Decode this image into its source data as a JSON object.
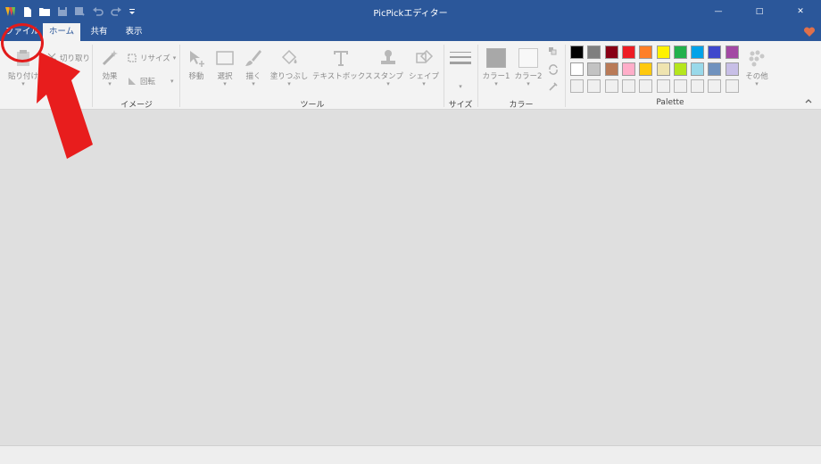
{
  "window": {
    "title": "PicPickエディター",
    "title_bar_color": "#2b579a"
  },
  "quick_access": {
    "icons": [
      "app-logo-icon",
      "new-file-icon",
      "open-folder-icon",
      "save-icon",
      "save-as-icon",
      "undo-icon",
      "redo-icon",
      "customize-icon"
    ]
  },
  "window_controls": {
    "minimize": "—",
    "maximize": "□",
    "close": "✕"
  },
  "tabs": [
    {
      "label": "ファイル"
    },
    {
      "label": "ホーム"
    },
    {
      "label": "共有"
    },
    {
      "label": "表示"
    }
  ],
  "ribbon": {
    "clipboard": {
      "paste": "貼り付け",
      "cut": "切り取り"
    },
    "image": {
      "label": "イメージ",
      "effects": "効果",
      "resize": "リサイズ",
      "rotate": "回転"
    },
    "tools": {
      "label": "ツール",
      "items": [
        "移動",
        "選択",
        "描く",
        "塗りつぶし",
        "テキストボックス",
        "スタンプ",
        "シェイプ"
      ]
    },
    "size": {
      "label": "サイズ"
    },
    "color": {
      "label": "カラー",
      "color1": "カラー1",
      "color2": "カラー2",
      "color1_value": "#a8a8a8",
      "color2_value": "#f8f8f8"
    },
    "palette": {
      "label": "Palette",
      "more": "その他",
      "row1": [
        "#000000",
        "#7f7f7f",
        "#880015",
        "#ed1c24",
        "#ff7f27",
        "#fff200",
        "#22b14c",
        "#00a2e8",
        "#3f48cc",
        "#a349a4"
      ],
      "row2": [
        "#ffffff",
        "#c3c3c3",
        "#b97a57",
        "#ffaec9",
        "#ffc90e",
        "#efe4b0",
        "#b5e61d",
        "#99d9ea",
        "#7092be",
        "#c8bfe7"
      ],
      "row3": [
        "#f0f0f0",
        "#f0f0f0",
        "#f0f0f0",
        "#f0f0f0",
        "#f0f0f0",
        "#f0f0f0",
        "#f0f0f0",
        "#f0f0f0",
        "#f0f0f0",
        "#f0f0f0"
      ]
    }
  },
  "annotation": {
    "color": "#e21b1b",
    "target": "ファイル"
  }
}
